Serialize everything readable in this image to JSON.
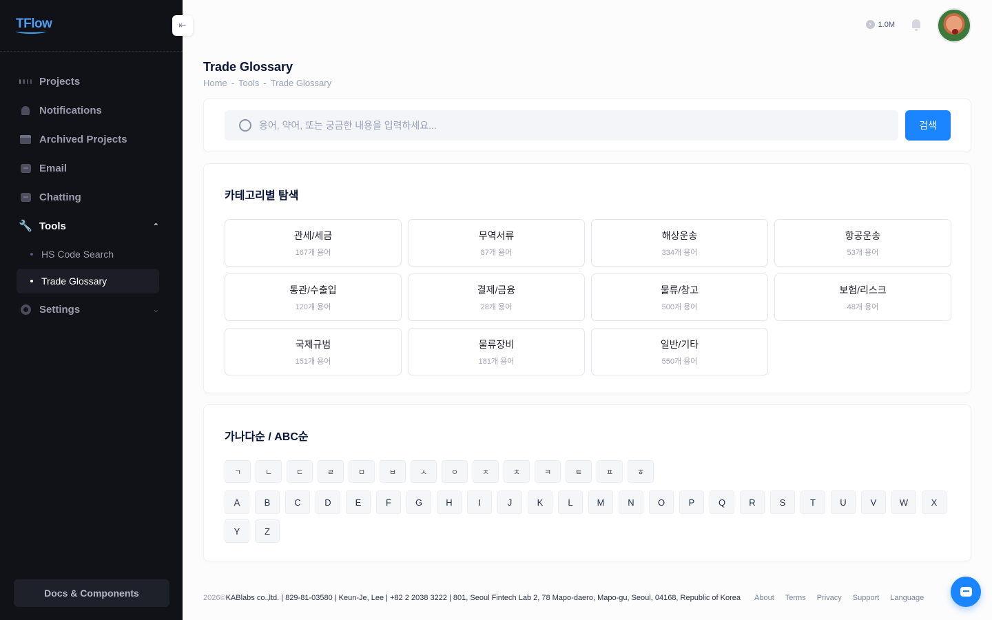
{
  "app": {
    "logo": "TFlow"
  },
  "sidebar": {
    "items": [
      {
        "label": "Projects",
        "icon": "grid-icon"
      },
      {
        "label": "Notifications",
        "icon": "bell-icon"
      },
      {
        "label": "Archived Projects",
        "icon": "archive-icon"
      },
      {
        "label": "Email",
        "icon": "message-icon"
      },
      {
        "label": "Chatting",
        "icon": "message-icon"
      },
      {
        "label": "Tools",
        "icon": "wrench-icon",
        "expanded": true
      },
      {
        "label": "Settings",
        "icon": "gear-icon",
        "expanded": false
      }
    ],
    "tools_sub": [
      {
        "label": "HS Code Search",
        "active": false
      },
      {
        "label": "Trade Glossary",
        "active": true
      }
    ],
    "docs_button": "Docs & Components",
    "collapse_icon": "arrow-left-icon"
  },
  "topbar": {
    "credits": "1.0M",
    "credit_icon": "bolt-icon",
    "bell_icon": "bell-icon",
    "avatar_icon": "avatar"
  },
  "page": {
    "title": "Trade Glossary",
    "breadcrumb": [
      "Home",
      "Tools",
      "Trade Glossary"
    ],
    "breadcrumb_sep": "-"
  },
  "search": {
    "placeholder": "용어, 약어, 또는 궁금한 내용을 입력하세요...",
    "value": "",
    "button": "검색"
  },
  "categories": {
    "title": "카테고리별 탐색",
    "items": [
      {
        "name": "관세/세금",
        "count": "167개 용어"
      },
      {
        "name": "무역서류",
        "count": "87개 용어"
      },
      {
        "name": "해상운송",
        "count": "334개 용어"
      },
      {
        "name": "항공운송",
        "count": "53개 용어"
      },
      {
        "name": "통관/수출입",
        "count": "120개 용어"
      },
      {
        "name": "결제/금융",
        "count": "28개 용어"
      },
      {
        "name": "물류/창고",
        "count": "500개 용어"
      },
      {
        "name": "보험/리스크",
        "count": "48개 용어"
      },
      {
        "name": "국제규범",
        "count": "151개 용어"
      },
      {
        "name": "물류장비",
        "count": "181개 용어"
      },
      {
        "name": "일반/기타",
        "count": "550개 용어"
      }
    ]
  },
  "alphabet": {
    "title": "가나다순 / ABC순",
    "hangul": [
      "ㄱ",
      "ㄴ",
      "ㄷ",
      "ㄹ",
      "ㅁ",
      "ㅂ",
      "ㅅ",
      "ㅇ",
      "ㅈ",
      "ㅊ",
      "ㅋ",
      "ㅌ",
      "ㅍ",
      "ㅎ"
    ],
    "latin": [
      "A",
      "B",
      "C",
      "D",
      "E",
      "F",
      "G",
      "H",
      "I",
      "J",
      "K",
      "L",
      "M",
      "N",
      "O",
      "P",
      "Q",
      "R",
      "S",
      "T",
      "U",
      "V",
      "W",
      "X",
      "Y",
      "Z"
    ]
  },
  "footer": {
    "year": "2026©",
    "company": "KABlabs co.,ltd. | 829-81-03580 | Keun-Je, Lee | +82 2 2038 3222 | 801, Seoul Fintech Lab 2, 78 Mapo-daero, Mapo-gu, Seoul, 04168, Republic of Korea",
    "links": [
      "About",
      "Terms",
      "Privacy",
      "Support",
      "Language"
    ]
  },
  "chat_fab_icon": "chat-icon",
  "colors": {
    "primary": "#1b84ff",
    "sidebar_bg": "#111217"
  }
}
